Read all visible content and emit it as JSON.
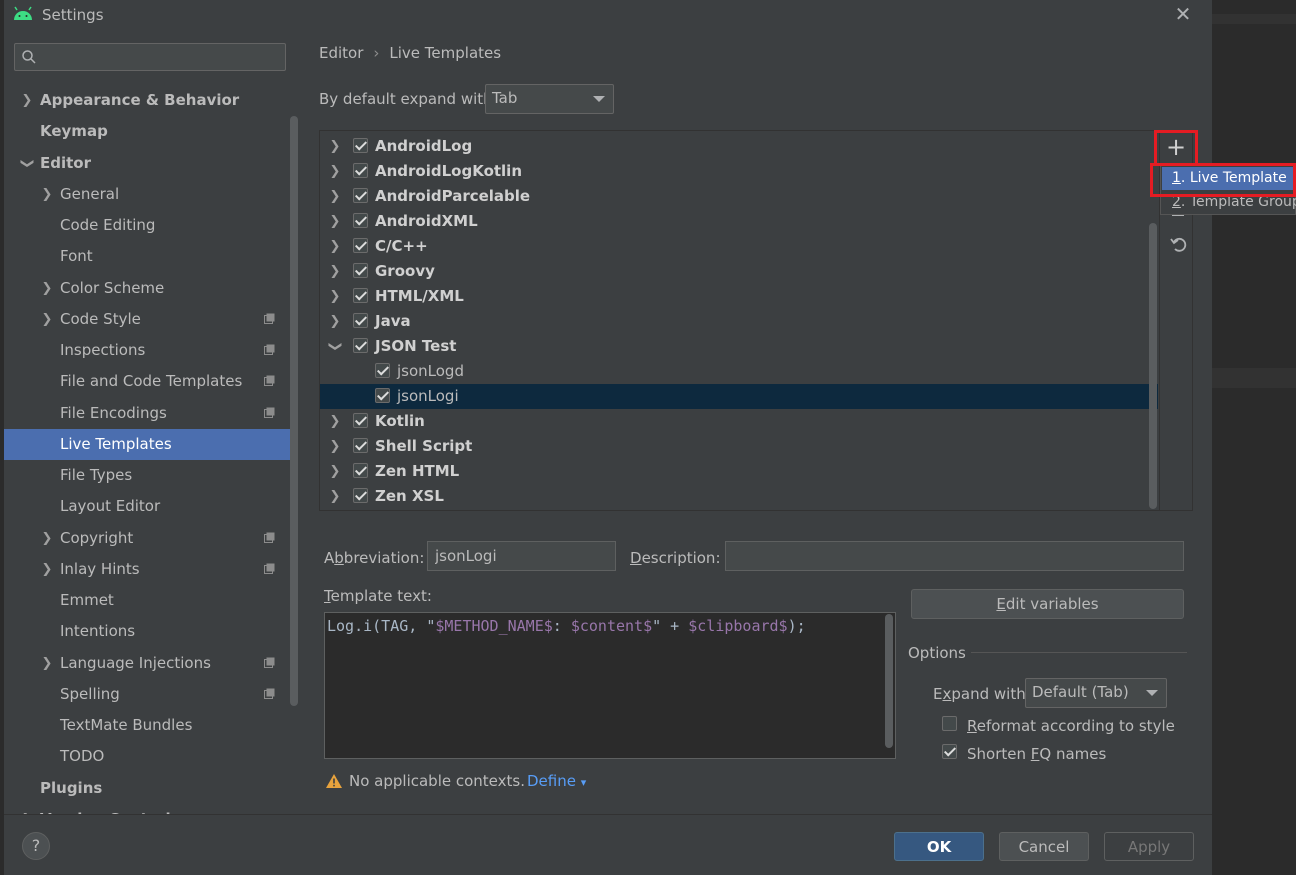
{
  "window": {
    "title": "Settings"
  },
  "search": {
    "placeholder": ""
  },
  "sidebar": {
    "items": [
      {
        "label": "Appearance & Behavior"
      },
      {
        "label": "Keymap"
      },
      {
        "label": "Editor"
      },
      {
        "label": "General"
      },
      {
        "label": "Code Editing"
      },
      {
        "label": "Font"
      },
      {
        "label": "Color Scheme"
      },
      {
        "label": "Code Style"
      },
      {
        "label": "Inspections"
      },
      {
        "label": "File and Code Templates"
      },
      {
        "label": "File Encodings"
      },
      {
        "label": "Live Templates"
      },
      {
        "label": "File Types"
      },
      {
        "label": "Layout Editor"
      },
      {
        "label": "Copyright"
      },
      {
        "label": "Inlay Hints"
      },
      {
        "label": "Emmet"
      },
      {
        "label": "Intentions"
      },
      {
        "label": "Language Injections"
      },
      {
        "label": "Spelling"
      },
      {
        "label": "TextMate Bundles"
      },
      {
        "label": "TODO"
      },
      {
        "label": "Plugins"
      },
      {
        "label": "Version Control"
      }
    ]
  },
  "breadcrumb": {
    "parent": "Editor",
    "current": "Live Templates"
  },
  "expand": {
    "label": "By default expand with",
    "value": "Tab"
  },
  "templates": {
    "groups": [
      {
        "label": "AndroidLog"
      },
      {
        "label": "AndroidLogKotlin"
      },
      {
        "label": "AndroidParcelable"
      },
      {
        "label": "AndroidXML"
      },
      {
        "label": "C/C++"
      },
      {
        "label": "Groovy"
      },
      {
        "label": "HTML/XML"
      },
      {
        "label": "Java"
      },
      {
        "label": "JSON Test"
      },
      {
        "label": "jsonLogd"
      },
      {
        "label": "jsonLogi"
      },
      {
        "label": "Kotlin"
      },
      {
        "label": "Shell Script"
      },
      {
        "label": "Zen HTML"
      },
      {
        "label": "Zen XSL"
      }
    ]
  },
  "add_menu": {
    "add_symbol": "+",
    "items": [
      {
        "num": "1",
        "label": ". Live Template"
      },
      {
        "num": "2",
        "label": ". Template Group..."
      }
    ]
  },
  "editor": {
    "abbreviation_pre": "A",
    "abbreviation_key": "b",
    "abbreviation_post": "breviation:",
    "abbreviation_value": "jsonLogi",
    "description_key": "D",
    "description_post": "escription:",
    "description_value": "",
    "template_text_key": "T",
    "template_text_post": "emplate text:",
    "code_pre": "Log.i(TAG, \"",
    "code_var1": "$METHOD_NAME$",
    "code_mid1": ": ",
    "code_var2": "$content$",
    "code_mid2": "\" + ",
    "code_var3": "$clipboard$",
    "code_post": ");",
    "edit_vars_key": "E",
    "edit_vars_post": "dit variables"
  },
  "options": {
    "title": "Options",
    "expand_pre": "E",
    "expand_key": "x",
    "expand_post": "pand with",
    "expand_value": "Default (Tab)",
    "reformat_key": "R",
    "reformat_post": "eformat according to style",
    "shorten_pre": "Shorten ",
    "shorten_key": "F",
    "shorten_post": "Q names"
  },
  "context": {
    "warning": "No applicable contexts.",
    "define": "Define"
  },
  "footer": {
    "help": "?",
    "ok": "OK",
    "cancel": "Cancel",
    "apply": "Apply"
  },
  "colors": {
    "accent": "#4b6eaf",
    "highlight_red": "#e51c23",
    "selected_row": "#0d293e"
  }
}
